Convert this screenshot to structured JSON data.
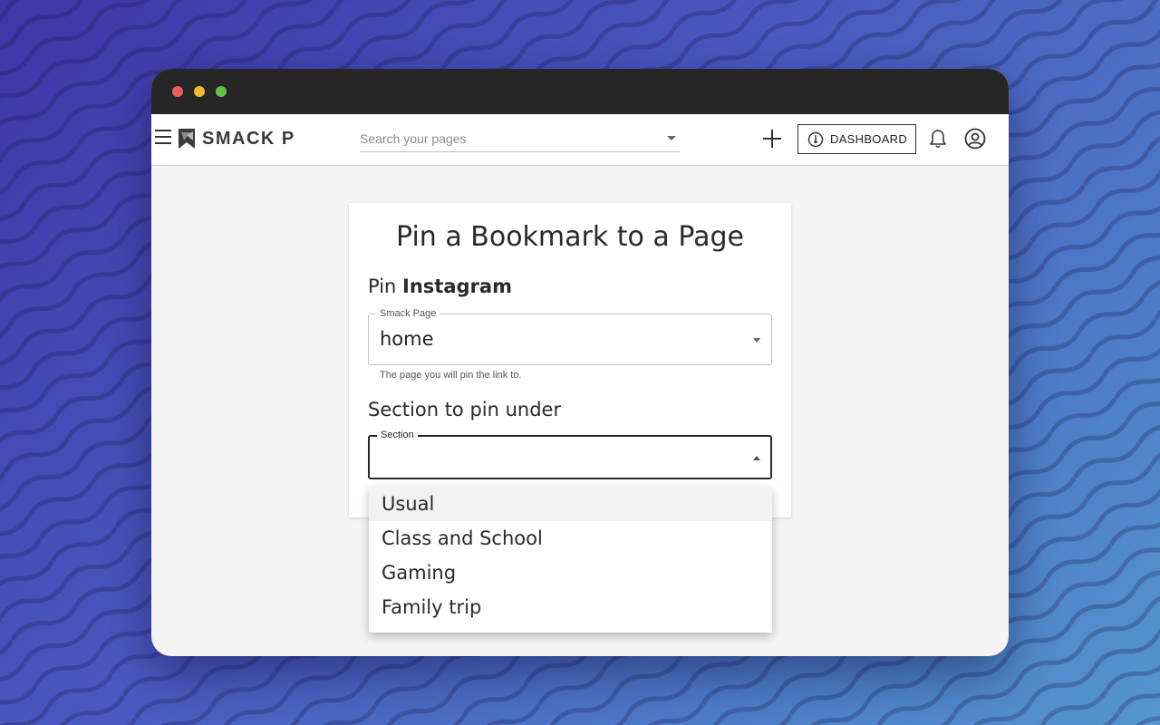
{
  "app": {
    "brand": "SMACK P"
  },
  "search": {
    "placeholder": "Search your pages"
  },
  "toolbar": {
    "dashboard_label": "DASHBOARD"
  },
  "dialog": {
    "title": "Pin a Bookmark to a Page",
    "pin_prefix": "Pin",
    "pin_target": "Instagram",
    "page_field": {
      "legend": "Smack Page",
      "value": "home",
      "helper": "The page you will pin the link to."
    },
    "section_heading": "Section to pin under",
    "section_field": {
      "legend": "Section",
      "value": ""
    }
  },
  "section_menu": {
    "options": [
      "Usual",
      "Class and School",
      "Gaming",
      "Family trip"
    ],
    "highlighted_index": 0
  },
  "colors": {
    "background_start": "#3f36a6",
    "background_end": "#5596d0",
    "titlebar": "#262626",
    "traffic_red": "#ec5f57",
    "traffic_yellow": "#f2b931",
    "traffic_green": "#5fc148"
  },
  "icons": [
    "menu-icon",
    "logo-icon",
    "dropdown-caret-icon",
    "plus-icon",
    "dashboard-gauge-icon",
    "bell-icon",
    "account-icon"
  ]
}
